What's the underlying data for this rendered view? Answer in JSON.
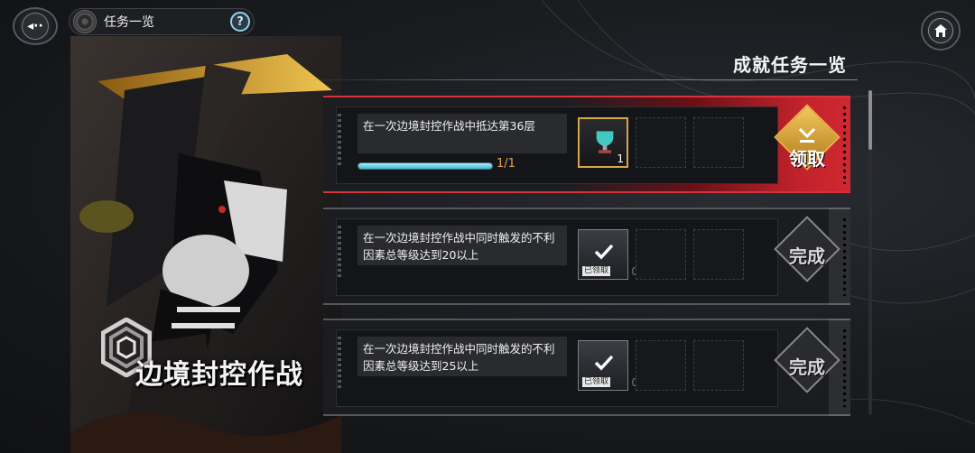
{
  "header": {
    "back_label": "◂··",
    "title": "任务一览",
    "help": "?",
    "section_title": "成就任务一览"
  },
  "operation": {
    "name": "边境封控作战"
  },
  "tasks": [
    {
      "description": "在一次边境封控作战中抵达第36层",
      "progress_text": "1/1",
      "progress": 1.0,
      "reward_qty": "1",
      "action": "领取",
      "state": "claimable"
    },
    {
      "description": "在一次边境封控作战中同时触发的不利因素总等级达到20以上",
      "reward_qty": "0",
      "claimed_tag": "已领取",
      "action": "完成",
      "state": "done"
    },
    {
      "description": "在一次边境封控作战中同时触发的不利因素总等级达到25以上",
      "reward_qty": "0",
      "claimed_tag": "已领取",
      "action": "完成",
      "state": "done"
    }
  ],
  "colors": {
    "accent_red": "#d02832",
    "progress_cyan": "#3db7d6",
    "gold": "#e6b04a"
  }
}
